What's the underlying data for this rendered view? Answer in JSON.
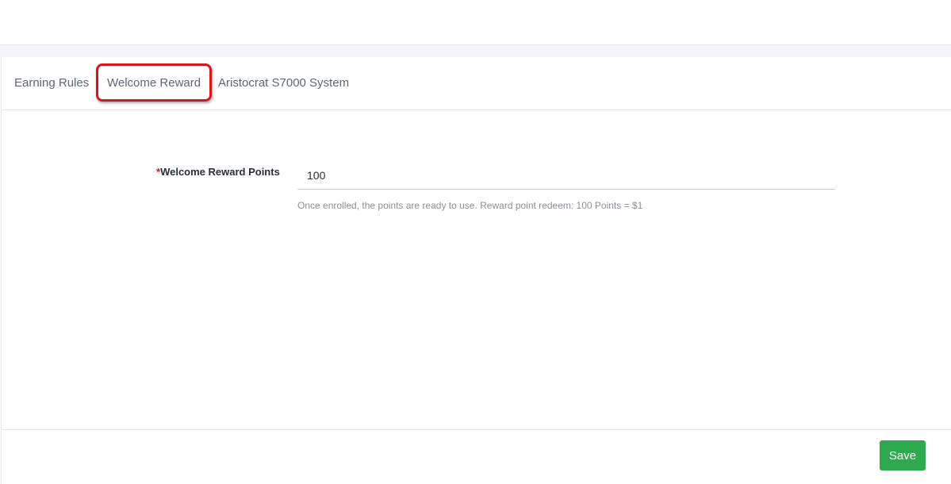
{
  "tabs": [
    {
      "label": "Earning Rules"
    },
    {
      "label": "Welcome Reward"
    },
    {
      "label": "Aristocrat S7000 System"
    }
  ],
  "form": {
    "required_mark": "*",
    "welcome_points_label": "Welcome Reward Points",
    "welcome_points_value": "100",
    "help_text": "Once enrolled, the points are ready to use. Reward point redeem: 100 Points = $1"
  },
  "footer": {
    "save_label": "Save"
  },
  "colors": {
    "save_button": "#2eaa4e",
    "highlight": "#d8161c",
    "required_mark": "#d8161c"
  }
}
